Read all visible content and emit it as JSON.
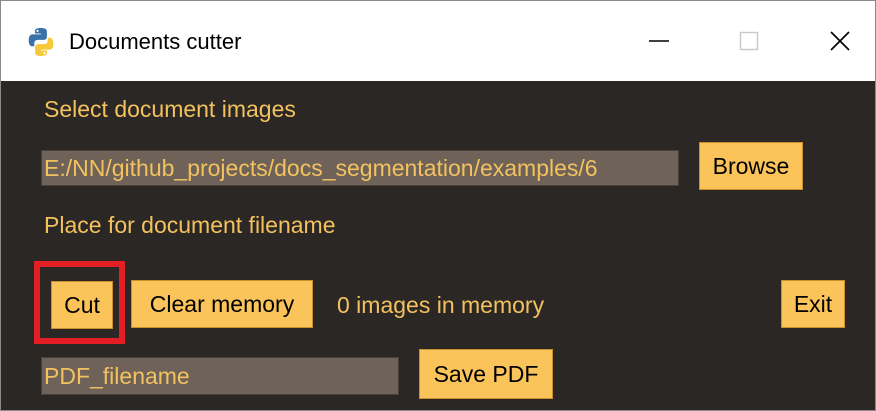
{
  "window": {
    "title": "Documents cutter",
    "controls": [
      "minimize",
      "maximize",
      "close"
    ]
  },
  "labels": {
    "select_images": "Select document images",
    "filename_placeholder": "Place for document filename",
    "memory_status": "0 images in memory"
  },
  "path_input": {
    "value": "E:/NN/github_projects/docs_segmentation/examples/6"
  },
  "pdf_input": {
    "value": "PDF_filename"
  },
  "buttons": {
    "browse": "Browse",
    "cut": "Cut",
    "clear_memory": "Clear memory",
    "exit": "Exit",
    "save_pdf": "Save PDF"
  },
  "colors": {
    "background": "#2b2725",
    "label_text": "#f3c25f",
    "button_bg": "#fbc45a",
    "entry_bg": "#6f6359",
    "highlight": "#e31e24"
  },
  "icons": {
    "app": "python-logo-icon",
    "minimize": "minimize-icon",
    "maximize": "maximize-icon",
    "close": "close-icon"
  }
}
